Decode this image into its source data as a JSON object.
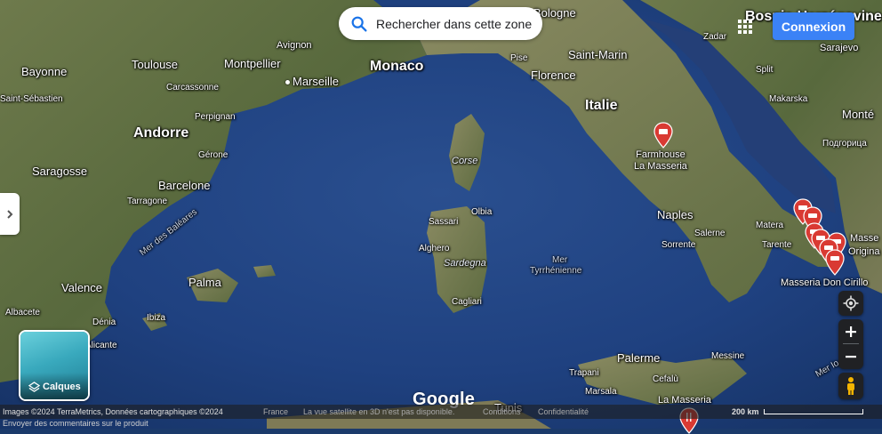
{
  "search": {
    "label": "Rechercher dans cette zone"
  },
  "header": {
    "login_label": "Connexion"
  },
  "layers": {
    "label": "Calques"
  },
  "branding": {
    "logo": "Google"
  },
  "footer": {
    "imagery": "Images ©2024 TerraMetrics, Données cartographiques ©2024",
    "country": "France",
    "note_3d": "La vue satellite en 3D n'est pas disponible.",
    "conditions": "Conditions",
    "privacy": "Confidentialité",
    "scale": "200 km",
    "feedback": "Envoyer des commentaires sur le produit"
  },
  "labels": {
    "bayonne": "Bayonne",
    "toulouse": "Toulouse",
    "montpellier": "Montpellier",
    "avignon": "Avignon",
    "marseille": "Marseille",
    "monaco": "Monaco",
    "carcassonne": "Carcassonne",
    "san_sebastian": "Saint-Sébastien",
    "perpignan": "Perpignan",
    "andorre": "Andorre",
    "gerone": "Gérone",
    "saragosse": "Saragosse",
    "barcelone": "Barcelone",
    "tarragone": "Tarragone",
    "mer_baleares": "Mer des Baléares",
    "palma": "Palma",
    "valence": "Valence",
    "albacete": "Albacete",
    "denia": "Dénia",
    "ibiza": "Ibiza",
    "alicante": "Alicante",
    "bologne": "Bologne",
    "pise": "Pise",
    "florence": "Florence",
    "saint_marin": "Saint-Marin",
    "italie": "Italie",
    "corse": "Corse",
    "sassari": "Sassari",
    "olbia": "Olbia",
    "alghero": "Alghero",
    "sardegna": "Sardegna",
    "cagliari": "Cagliari",
    "mer_tyrrhenienne_1": "Mer",
    "mer_tyrrhenienne_2": "Tyrrhénienne",
    "farmhouse_1": "Farmhouse",
    "farmhouse_2": "La Masseria",
    "naples": "Naples",
    "salerne": "Salerne",
    "sorrente": "Sorrente",
    "matera": "Matera",
    "tarente": "Tarente",
    "masseria_don_cirillo": "Masseria Don Cirillo",
    "masse": "Masse",
    "origina": "Origina",
    "palerme": "Palerme",
    "messine": "Messine",
    "trapani": "Trapani",
    "cefalu": "Cefalù",
    "marsala": "Marsala",
    "la_masseria": "La Masseria",
    "tunis": "Tunis",
    "mer_ionienne": "Mer Io",
    "zadar": "Zadar",
    "split": "Split",
    "makarska": "Makarska",
    "bosnie": "Bosnie-Herzégovine",
    "sarajevo": "Sarajevo",
    "montenegro": "Monté",
    "podgorica": "Подгорица"
  },
  "colors": {
    "pin_red": "#d93a33",
    "button_blue": "#3b82f6",
    "control_dark": "#202124"
  }
}
